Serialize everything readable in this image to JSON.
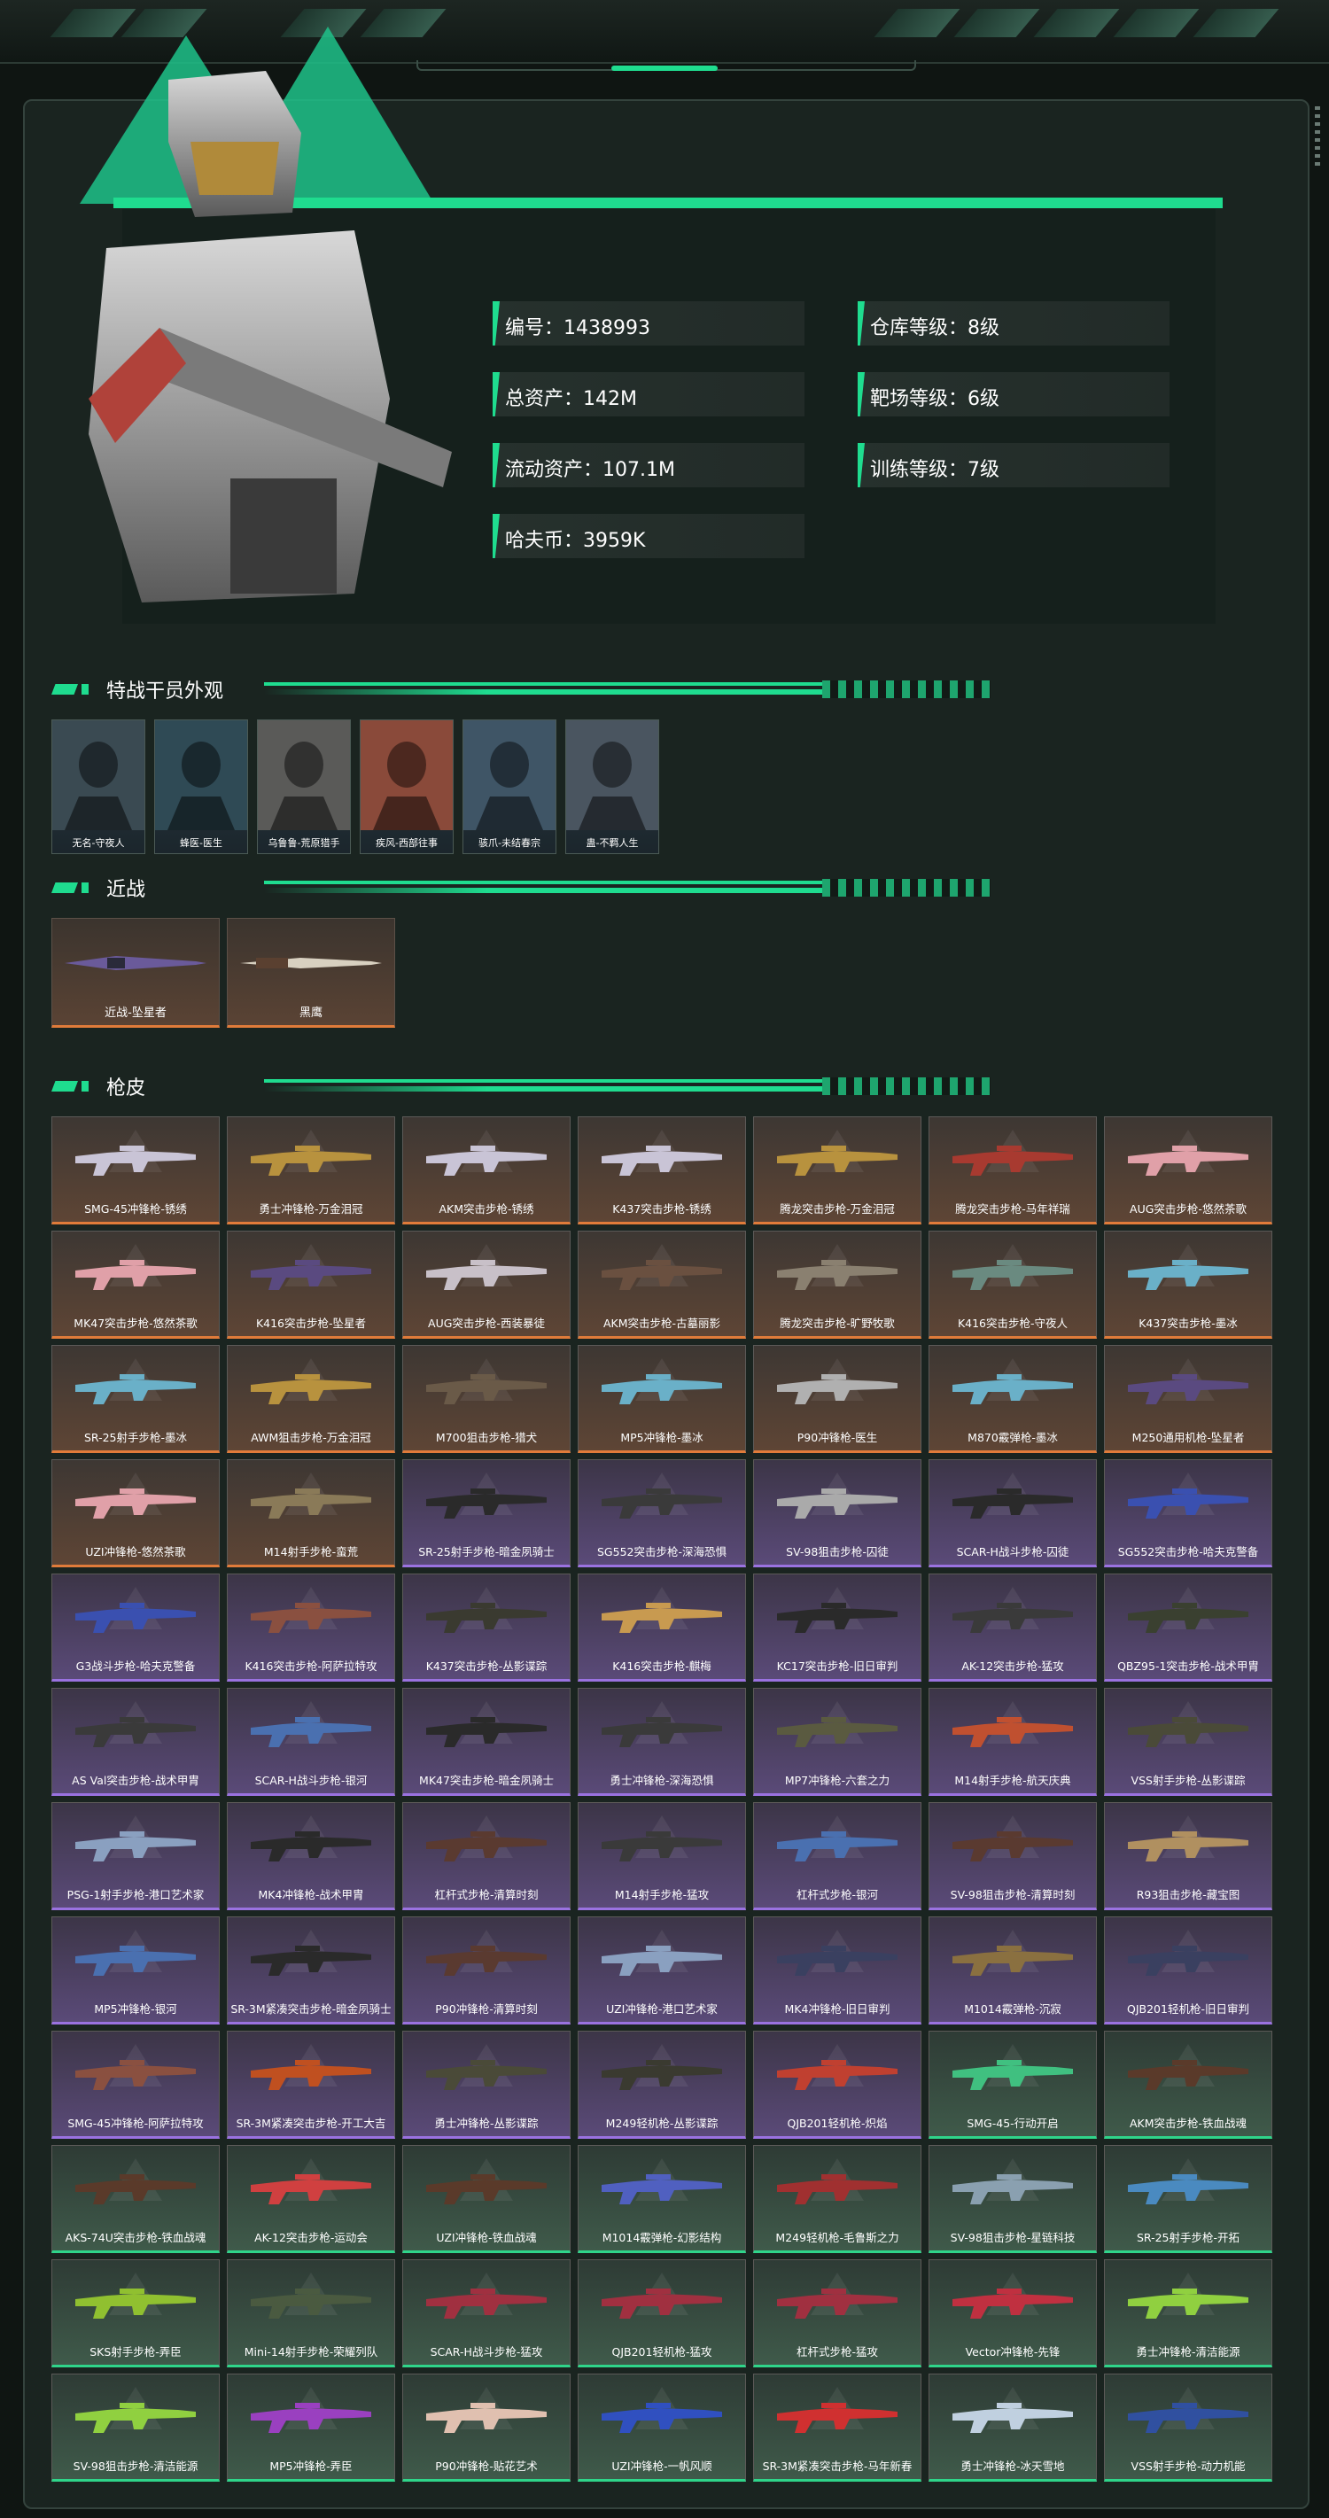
{
  "profile": {
    "id_label": "编号：",
    "id_value": "1438993",
    "assets_label": "总资产：",
    "assets_value": "142M",
    "liquid_label": "流动资产：",
    "liquid_value": "107.1M",
    "coin_label": "哈夫币：",
    "coin_value": "3959K",
    "warehouse_label": "仓库等级：",
    "warehouse_value": "8级",
    "range_label": "靶场等级：",
    "range_value": "6级",
    "training_label": "训练等级：",
    "training_value": "7级"
  },
  "sections": {
    "operators_title": "特战干员外观",
    "melee_title": "近战",
    "skins_title": "枪皮"
  },
  "operators": [
    {
      "name": "无名-守夜人",
      "color": "#3a4a52"
    },
    {
      "name": "蜂医-医生",
      "color": "#2f4a55"
    },
    {
      "name": "乌鲁鲁-荒原猎手",
      "color": "#5a5a58"
    },
    {
      "name": "疾风-西部往事",
      "color": "#8a4a3a"
    },
    {
      "name": "骇爪-未结春宗",
      "color": "#3f5566"
    },
    {
      "name": "蛊-不羁人生",
      "color": "#4a5560"
    }
  ],
  "melee": [
    {
      "name": "近战-坠星者"
    },
    {
      "name": "黑鹰"
    }
  ],
  "skins": [
    {
      "name": "SMG-45冲锋枪-锈绣",
      "rarity": "o",
      "gun": "#c9c4d6"
    },
    {
      "name": "勇士冲锋枪-万金泪冠",
      "rarity": "o",
      "gun": "#b8923e"
    },
    {
      "name": "AKM突击步枪-锈绣",
      "rarity": "o",
      "gun": "#c9c4d6"
    },
    {
      "name": "K437突击步枪-锈绣",
      "rarity": "o",
      "gun": "#c9c4d6"
    },
    {
      "name": "腾龙突击步枪-万金泪冠",
      "rarity": "o",
      "gun": "#b8923e"
    },
    {
      "name": "腾龙突击步枪-马年祥瑞",
      "rarity": "o",
      "gun": "#a83a30"
    },
    {
      "name": "AUG突击步枪-悠然茶歌",
      "rarity": "o",
      "gun": "#e0a0a8"
    },
    {
      "name": "MK47突击步枪-悠然茶歌",
      "rarity": "o",
      "gun": "#e0a0a8"
    },
    {
      "name": "K416突击步枪-坠星者",
      "rarity": "o",
      "gun": "#5a4a80"
    },
    {
      "name": "AUG突击步枪-西装暴徒",
      "rarity": "o",
      "gun": "#c8c0c8"
    },
    {
      "name": "AKM突击步枪-古墓丽影",
      "rarity": "o",
      "gun": "#6a5040"
    },
    {
      "name": "腾龙突击步枪-旷野牧歌",
      "rarity": "o",
      "gun": "#8a8070"
    },
    {
      "name": "K416突击步枪-守夜人",
      "rarity": "o",
      "gun": "#6a8a80"
    },
    {
      "name": "K437突击步枪-墨冰",
      "rarity": "o",
      "gun": "#6ab0c8"
    },
    {
      "name": "SR-25射手步枪-墨冰",
      "rarity": "o",
      "gun": "#6ab0c8"
    },
    {
      "name": "AWM狙击步枪-万金泪冠",
      "rarity": "o",
      "gun": "#b8923e"
    },
    {
      "name": "M700狙击步枪-猎犬",
      "rarity": "o",
      "gun": "#6a5a48"
    },
    {
      "name": "MP5冲锋枪-墨冰",
      "rarity": "o",
      "gun": "#6ab0c8"
    },
    {
      "name": "P90冲锋枪-医生",
      "rarity": "o",
      "gun": "#b0b0b0"
    },
    {
      "name": "M870霰弹枪-墨冰",
      "rarity": "o",
      "gun": "#6ab0c8"
    },
    {
      "name": "M250通用机枪-坠星者",
      "rarity": "o",
      "gun": "#5a4a80"
    },
    {
      "name": "UZI冲锋枪-悠然茶歌",
      "rarity": "o",
      "gun": "#e0a0a8"
    },
    {
      "name": "M14射手步枪-蛮荒",
      "rarity": "o",
      "gun": "#8a7a58"
    },
    {
      "name": "SR-25射手步枪-暗金夙骑士",
      "rarity": "p",
      "gun": "#2a2a2a"
    },
    {
      "name": "SG552突击步枪-深海恐惧",
      "rarity": "p",
      "gun": "#3a3a3a"
    },
    {
      "name": "SV-98狙击步枪-囚徒",
      "rarity": "p",
      "gun": "#aaaaaa"
    },
    {
      "name": "SCAR-H战斗步枪-囚徒",
      "rarity": "p",
      "gun": "#2a2a2a"
    },
    {
      "name": "SG552突击步枪-哈夫克警备",
      "rarity": "p",
      "gun": "#3a50b0"
    },
    {
      "name": "G3战斗步枪-哈夫克警备",
      "rarity": "p",
      "gun": "#3a50b0"
    },
    {
      "name": "K416突击步枪-阿萨拉特攻",
      "rarity": "p",
      "gun": "#8a5040"
    },
    {
      "name": "K437突击步枪-丛影谍踪",
      "rarity": "p",
      "gun": "#3a3a30"
    },
    {
      "name": "K416突击步枪-麒梅",
      "rarity": "p",
      "gun": "#c89a50"
    },
    {
      "name": "KC17突击步枪-旧日审判",
      "rarity": "p",
      "gun": "#2a2a2a"
    },
    {
      "name": "AK-12突击步枪-猛攻",
      "rarity": "p",
      "gun": "#3a3a3a"
    },
    {
      "name": "QBZ95-1突击步枪-战术甲胄",
      "rarity": "p",
      "gun": "#3a4030"
    },
    {
      "name": "AS Val突击步枪-战术甲胄",
      "rarity": "p",
      "gun": "#3a3a3a"
    },
    {
      "name": "SCAR-H战斗步枪-银河",
      "rarity": "p",
      "gun": "#4a70b0"
    },
    {
      "name": "MK47突击步枪-暗金夙骑士",
      "rarity": "p",
      "gun": "#2a2a2a"
    },
    {
      "name": "勇士冲锋枪-深海恐惧",
      "rarity": "p",
      "gun": "#3a3a3a"
    },
    {
      "name": "MP7冲锋枪-六套之力",
      "rarity": "p",
      "gun": "#5a5a40"
    },
    {
      "name": "M14射手步枪-航天庆典",
      "rarity": "p",
      "gun": "#c05030"
    },
    {
      "name": "VSS射手步枪-丛影谍踪",
      "rarity": "p",
      "gun": "#4a4a38"
    },
    {
      "name": "PSG-1射手步枪-港口艺术家",
      "rarity": "p",
      "gun": "#8aa0c0"
    },
    {
      "name": "MK4冲锋枪-战术甲胄",
      "rarity": "p",
      "gun": "#2a2a2a"
    },
    {
      "name": "杠杆式步枪-清算时刻",
      "rarity": "p",
      "gun": "#5a3a30"
    },
    {
      "name": "M14射手步枪-猛攻",
      "rarity": "p",
      "gun": "#3a3a3a"
    },
    {
      "name": "杠杆式步枪-银河",
      "rarity": "p",
      "gun": "#4a70b0"
    },
    {
      "name": "SV-98狙击步枪-清算时刻",
      "rarity": "p",
      "gun": "#5a3a30"
    },
    {
      "name": "R93狙击步枪-藏宝图",
      "rarity": "p",
      "gun": "#b09060"
    },
    {
      "name": "MP5冲锋枪-银河",
      "rarity": "p",
      "gun": "#4a70b0"
    },
    {
      "name": "SR-3M紧凑突击步枪-暗金夙骑士",
      "rarity": "p",
      "gun": "#2a2a2a"
    },
    {
      "name": "P90冲锋枪-清算时刻",
      "rarity": "p",
      "gun": "#5a3a30"
    },
    {
      "name": "UZI冲锋枪-港口艺术家",
      "rarity": "p",
      "gun": "#8aa0c0"
    },
    {
      "name": "MK4冲锋枪-旧日审判",
      "rarity": "p",
      "gun": "#3a4060"
    },
    {
      "name": "M1014霰弹枪-沉寂",
      "rarity": "p",
      "gun": "#8a7040"
    },
    {
      "name": "QJB201轻机枪-旧日审判",
      "rarity": "p",
      "gun": "#3a4060"
    },
    {
      "name": "SMG-45冲锋枪-阿萨拉特攻",
      "rarity": "p",
      "gun": "#8a5040"
    },
    {
      "name": "SR-3M紧凑突击步枪-开工大吉",
      "rarity": "p",
      "gun": "#c05020"
    },
    {
      "name": "勇士冲锋枪-丛影谍踪",
      "rarity": "p",
      "gun": "#4a4a38"
    },
    {
      "name": "M249轻机枪-丛影谍踪",
      "rarity": "p",
      "gun": "#3a3a30"
    },
    {
      "name": "QJB201轻机枪-炽焰",
      "rarity": "p",
      "gun": "#c04030"
    },
    {
      "name": "SMG-45-行动开启",
      "rarity": "g",
      "gun": "#40c080"
    },
    {
      "name": "AKM突击步枪-铁血战魂",
      "rarity": "g",
      "gun": "#5a3a2a"
    },
    {
      "name": "AKS-74U突击步枪-铁血战魂",
      "rarity": "g",
      "gun": "#5a3a2a"
    },
    {
      "name": "AK-12突击步枪-运动会",
      "rarity": "g",
      "gun": "#d04040"
    },
    {
      "name": "UZI冲锋枪-铁血战魂",
      "rarity": "g",
      "gun": "#5a3a2a"
    },
    {
      "name": "M1014霰弹枪-幻影结构",
      "rarity": "g",
      "gun": "#5060c0"
    },
    {
      "name": "M249轻机枪-毛鲁斯之力",
      "rarity": "g",
      "gun": "#a03030"
    },
    {
      "name": "SV-98狙击步枪-星链科技",
      "rarity": "g",
      "gun": "#8aa0b0"
    },
    {
      "name": "SR-25射手步枪-开拓",
      "rarity": "g",
      "gun": "#4a8ac0"
    },
    {
      "name": "SKS射手步枪-弄臣",
      "rarity": "g",
      "gun": "#90c030"
    },
    {
      "name": "Mini-14射手步枪-荣耀列队",
      "rarity": "g",
      "gun": "#4a5a40"
    },
    {
      "name": "SCAR-H战斗步枪-猛攻",
      "rarity": "g",
      "gun": "#a03040"
    },
    {
      "name": "QJB201轻机枪-猛攻",
      "rarity": "g",
      "gun": "#a03040"
    },
    {
      "name": "杠杆式步枪-猛攻",
      "rarity": "g",
      "gun": "#a03040"
    },
    {
      "name": "Vector冲锋枪-先锋",
      "rarity": "g",
      "gun": "#c03040"
    },
    {
      "name": "勇士冲锋枪-清洁能源",
      "rarity": "g",
      "gun": "#90d040"
    },
    {
      "name": "SV-98狙击步枪-清洁能源",
      "rarity": "g",
      "gun": "#90d040"
    },
    {
      "name": "MP5冲锋枪-弄臣",
      "rarity": "g",
      "gun": "#9a40c0"
    },
    {
      "name": "P90冲锋枪-贴花艺术",
      "rarity": "g",
      "gun": "#e0c0b0"
    },
    {
      "name": "UZI冲锋枪-一帆风顺",
      "rarity": "g",
      "gun": "#3050c0"
    },
    {
      "name": "SR-3M紧凑突击步枪-马年新春",
      "rarity": "g",
      "gun": "#d03030"
    },
    {
      "name": "勇士冲锋枪-冰天雪地",
      "rarity": "g",
      "gun": "#c0d0e0"
    },
    {
      "name": "VSS射手步枪-动力机能",
      "rarity": "g",
      "gun": "#3050a0"
    }
  ]
}
